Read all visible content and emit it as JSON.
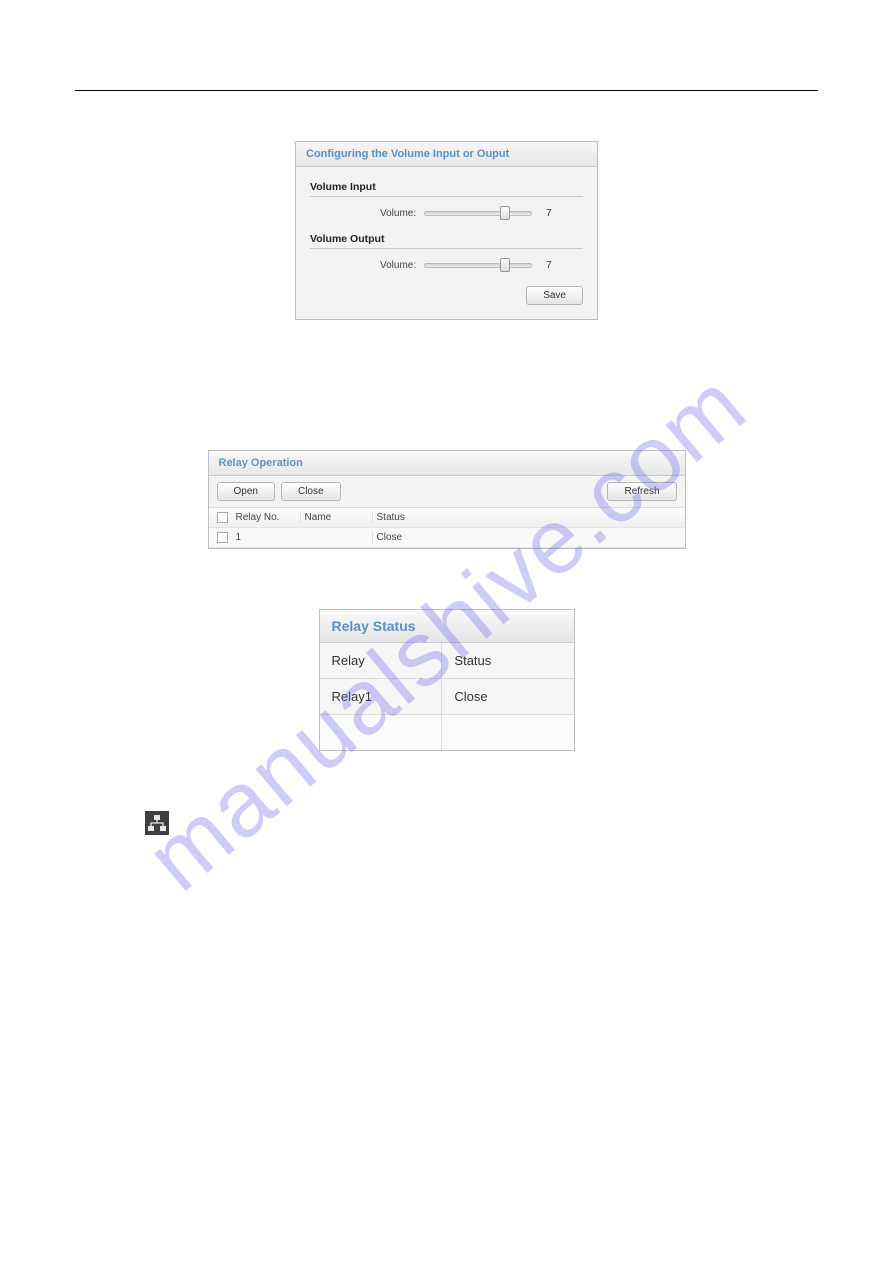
{
  "watermark": "manualshive.com",
  "volume_panel": {
    "title": "Configuring the Volume Input or Ouput",
    "input_section": "Volume Input",
    "output_section": "Volume Output",
    "volume_label": "Volume:",
    "input_value": "7",
    "output_value": "7",
    "save_label": "Save"
  },
  "relay_op": {
    "title": "Relay Operation",
    "open_label": "Open",
    "close_label": "Close",
    "refresh_label": "Refresh",
    "col_no": "Relay No.",
    "col_name": "Name",
    "col_status": "Status",
    "rows": [
      {
        "no": "1",
        "name": "",
        "status": "Close"
      }
    ]
  },
  "relay_status": {
    "title": "Relay Status",
    "col_relay": "Relay",
    "col_status": "Status",
    "rows": [
      {
        "relay": "Relay1",
        "status": "Close"
      }
    ]
  }
}
